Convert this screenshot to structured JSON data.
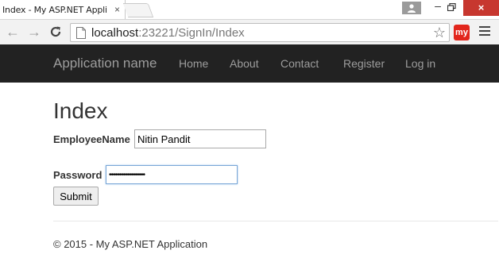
{
  "browser": {
    "tab_title": "Index - My ASP.NET Appli",
    "tab_close": "×",
    "window_minimize": "–",
    "window_close": "×",
    "back_glyph": "←",
    "forward_glyph": "→",
    "reload_glyph": "C",
    "address": {
      "host": "localhost",
      "port": ":23221",
      "path": "/SignIn/Index"
    },
    "bookmark_glyph": "☆",
    "extension_label": "my"
  },
  "navbar": {
    "brand": "Application name",
    "links": [
      "Home",
      "About",
      "Contact",
      "Register",
      "Log in"
    ]
  },
  "page": {
    "title": "Index",
    "employee_name_label": "EmployeeName",
    "employee_name_value": "Nitin Pandit",
    "password_label": "Password",
    "password_value": "••••••••••••••••••",
    "submit_label": "Submit",
    "footer": "© 2015 - My ASP.NET Application"
  },
  "colors": {
    "navbar_bg": "#222222",
    "nav_text": "#9d9d9d",
    "close_button": "#c7372f",
    "extension": "#e2261c"
  }
}
